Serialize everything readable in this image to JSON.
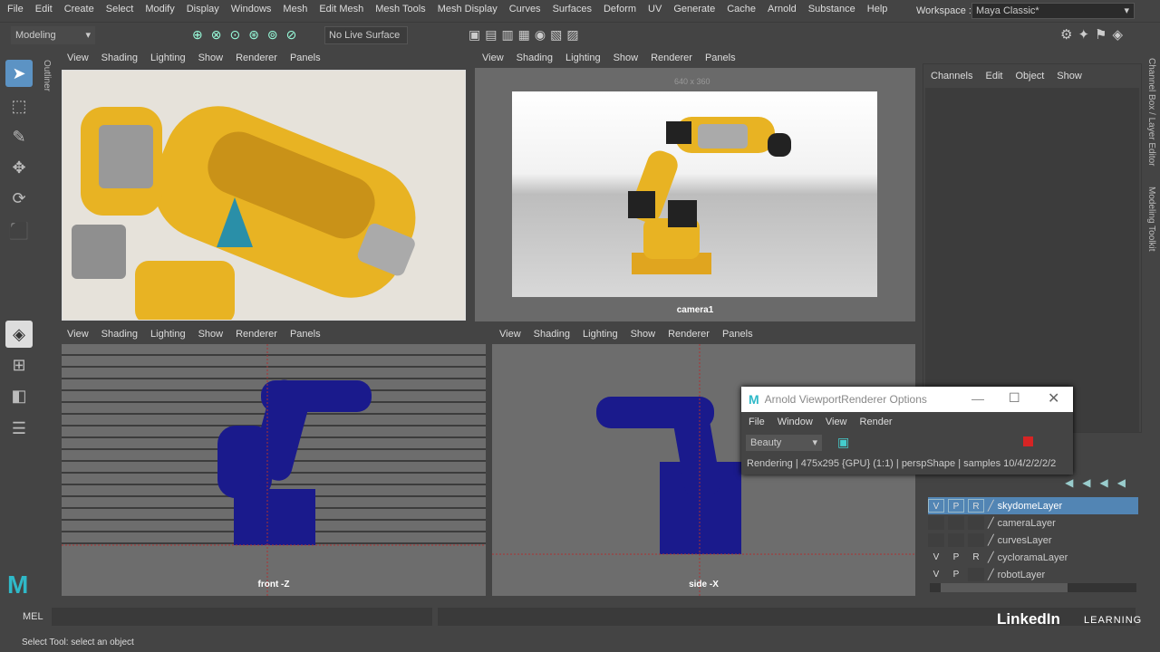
{
  "menubar": {
    "items": [
      "File",
      "Edit",
      "Create",
      "Select",
      "Modify",
      "Display",
      "Windows",
      "Mesh",
      "Edit Mesh",
      "Mesh Tools",
      "Mesh Display",
      "Curves",
      "Surfaces",
      "Deform",
      "UV",
      "Generate",
      "Cache",
      "Arnold",
      "Substance",
      "Help"
    ],
    "workspace_label": "Workspace :",
    "workspace_value": "Maya Classic*"
  },
  "toolbar": {
    "mode": "Modeling",
    "live_surface": "No Live Surface"
  },
  "outliner_tab": "Outliner",
  "viewport_menu": [
    "View",
    "Shading",
    "Lighting",
    "Show",
    "Renderer",
    "Panels"
  ],
  "viewports": {
    "top_right": {
      "resolution": "640 x 360",
      "camera": "camera1"
    },
    "bottom_left": {
      "camera": "front -Z"
    },
    "bottom_right": {
      "camera": "side -X"
    }
  },
  "channel_box": {
    "menu": [
      "Channels",
      "Edit",
      "Object",
      "Show"
    ]
  },
  "right_tabs": {
    "channel": "Channel Box / Layer Editor",
    "modeling": "Modeling Toolkit"
  },
  "layers": [
    {
      "v": "V",
      "p": "P",
      "r": "R",
      "name": "skydomeLayer",
      "selected": true
    },
    {
      "v": "",
      "p": "",
      "r": "",
      "name": "cameraLayer"
    },
    {
      "v": "",
      "p": "",
      "r": "",
      "name": "curvesLayer"
    },
    {
      "v": "V",
      "p": "P",
      "r": "R",
      "name": "cycloramaLayer"
    },
    {
      "v": "V",
      "p": "P",
      "r": "",
      "name": "robotLayer"
    }
  ],
  "arnold_dialog": {
    "title": "Arnold ViewportRenderer Options",
    "menu": [
      "File",
      "Window",
      "View",
      "Render"
    ],
    "aov": "Beauty",
    "status": "Rendering | 475x295 {GPU} (1:1) | perspShape  | samples 10/4/2/2/2/2"
  },
  "command_line": {
    "label": "MEL"
  },
  "status_line": "Select Tool: select an object",
  "watermark": {
    "brand": "LinkedIn",
    "learning": "LEARNING"
  },
  "colors": {
    "robot_yellow": "#e8b323",
    "robot_blue": "#1a1a8c",
    "accent_blue": "#5c93c4",
    "selected_layer": "#5285b4"
  }
}
